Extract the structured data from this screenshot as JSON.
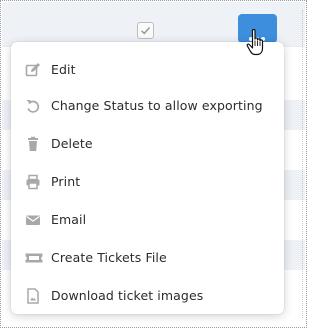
{
  "toolbar": {
    "more_button_glyph": "•••",
    "checkbox_checked": true
  },
  "menu": {
    "items": [
      {
        "label": "Edit",
        "icon": "edit-icon"
      },
      {
        "label": "Change Status to allow exporting",
        "icon": "undo-icon"
      },
      {
        "label": "Delete",
        "icon": "trash-icon"
      },
      {
        "label": "Print",
        "icon": "printer-icon"
      },
      {
        "label": "Email",
        "icon": "envelope-icon"
      },
      {
        "label": "Create Tickets File",
        "icon": "ticket-icon"
      },
      {
        "label": "Download ticket images",
        "icon": "file-image-icon"
      }
    ]
  },
  "colors": {
    "accent": "#3d8fde",
    "icon": "#a8a8a8",
    "text": "#2b2b2b"
  }
}
